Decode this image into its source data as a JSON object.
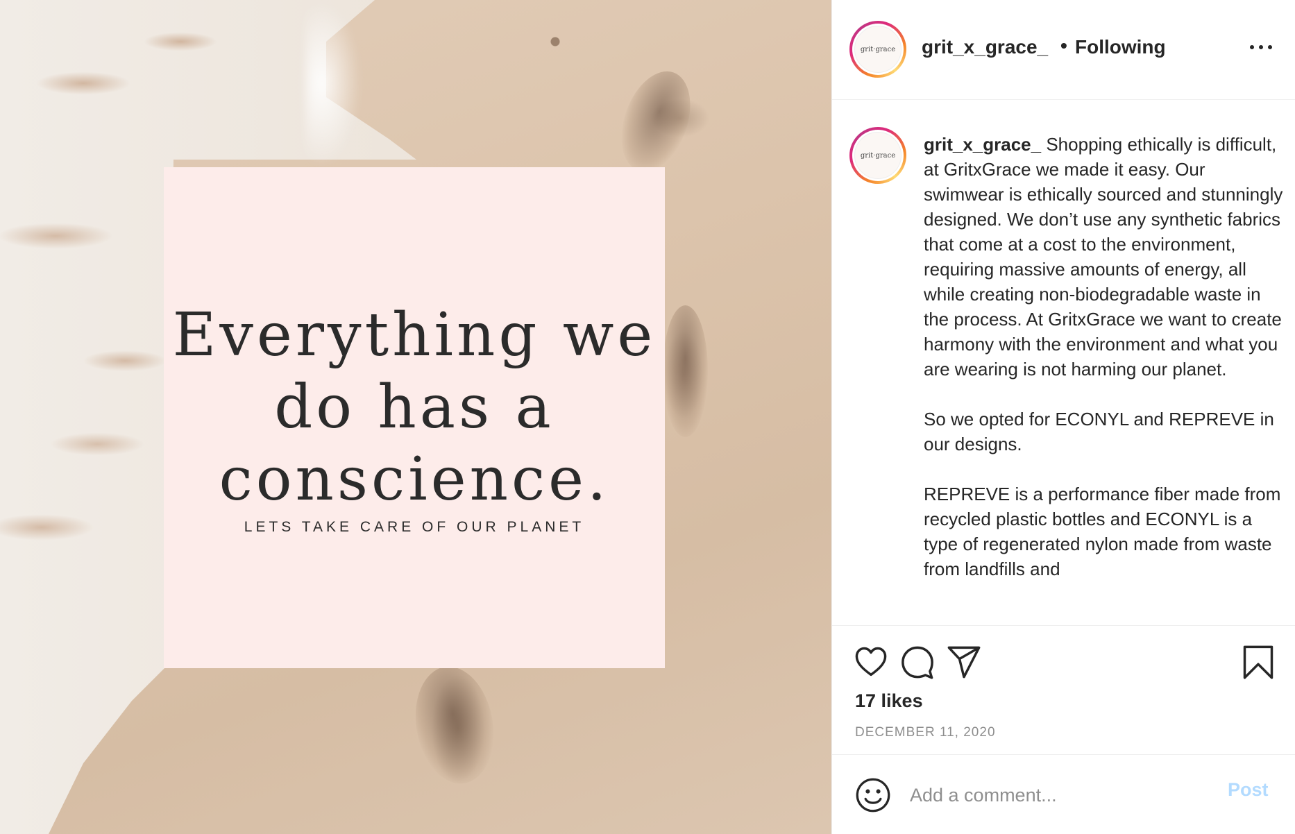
{
  "post": {
    "quote": {
      "line1": "Everything we",
      "line2": "do has a",
      "line3": "conscience.",
      "subtitle": "LETS TAKE CARE OF OUR PLANET"
    },
    "avatar_text": "grit·grace"
  },
  "header": {
    "username": "grit_x_grace_",
    "separator": "•",
    "follow_status": "Following",
    "more_icon": "more-horizontal-icon"
  },
  "caption": {
    "username": "grit_x_grace_",
    "text": "Shopping ethically is difficult, at GritxGrace we made it easy. Our swimwear is ethically sourced and stunningly designed. We don’t use any synthetic fabrics that come at a cost to the environment, requiring massive amounts of energy, all while creating non-biodegradable waste in the process. At GritxGrace we want to create harmony with the environment and what you are wearing is not harming our planet.\n\nSo we opted for ECONYL and REPREVE in our designs.\n\nREPREVE is a performance fiber made from recycled plastic bottles and ECONYL is a type of regenerated nylon made from waste from landfills and"
  },
  "actions": {
    "icons": [
      "heart-icon",
      "comment-icon",
      "share-icon",
      "bookmark-icon"
    ],
    "likes": "17 likes",
    "date": "DECEMBER 11, 2020"
  },
  "comment": {
    "placeholder": "Add a comment...",
    "post_label": "Post",
    "emoji_icon": "emoji-icon"
  },
  "colors": {
    "text": "#262626",
    "muted": "#8e8e8e",
    "post_disabled": "#b3dbff",
    "card_bg": "#fdecea",
    "divider": "#efefef"
  }
}
